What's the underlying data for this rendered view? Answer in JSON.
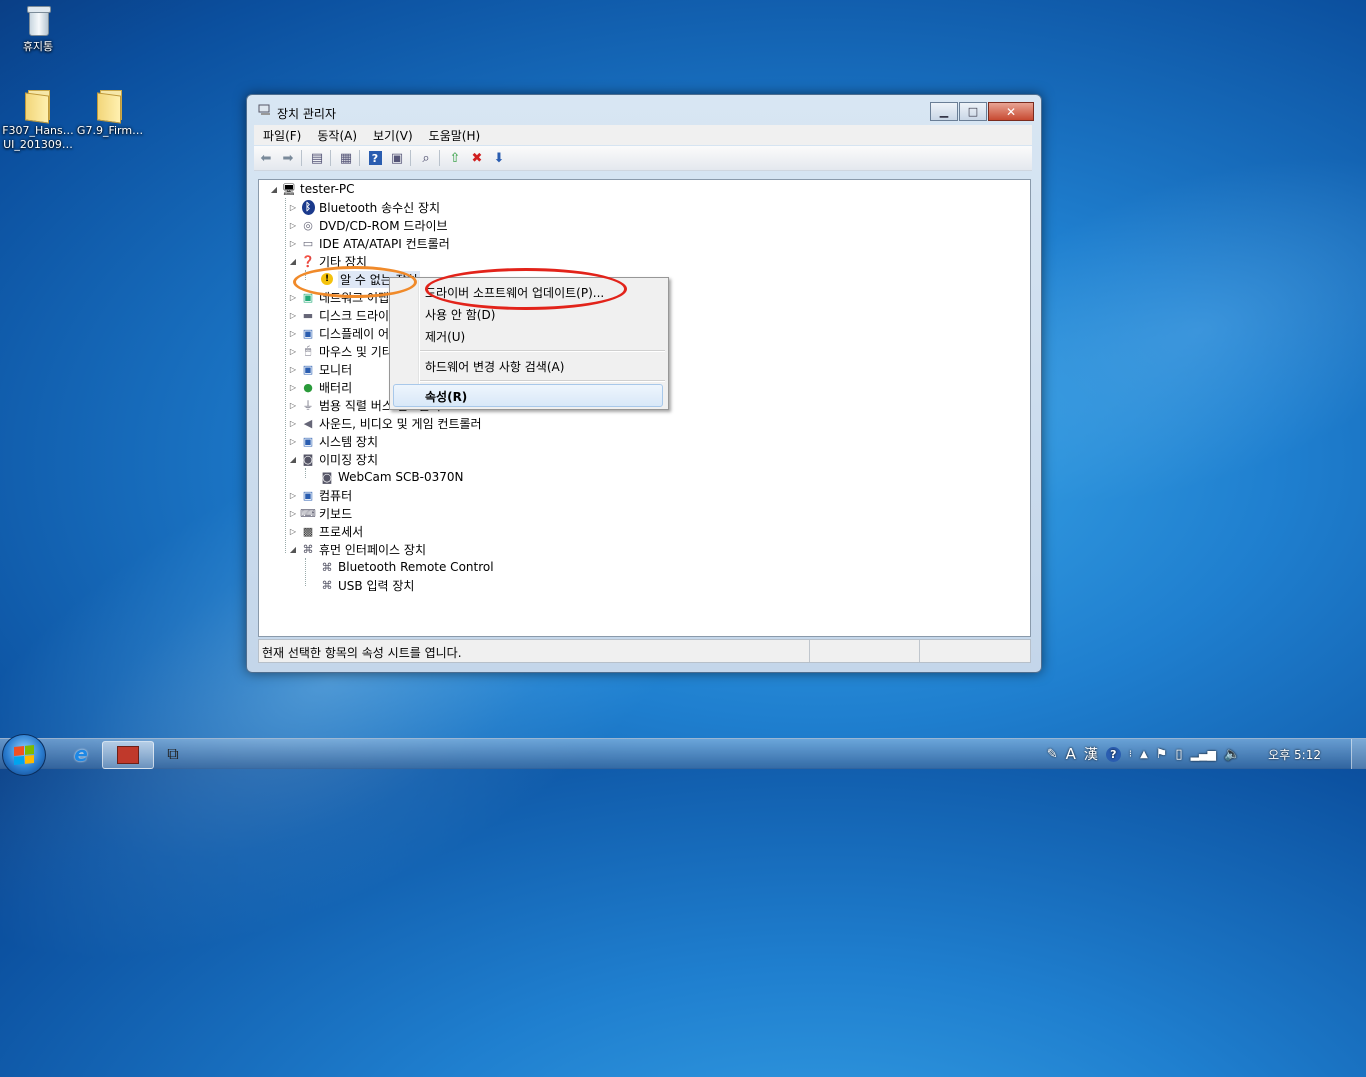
{
  "desktop": {
    "icons": [
      {
        "label": "휴지통"
      },
      {
        "label": "F307_Hans… UI_201309…"
      },
      {
        "label": "G7.9_Firm…"
      }
    ]
  },
  "window": {
    "title": "장치 관리자",
    "buttons": {
      "minimize": "▁",
      "maximize": "□",
      "close": "✕"
    }
  },
  "menubar": [
    "파일(F)",
    "동작(A)",
    "보기(V)",
    "도움말(H)"
  ],
  "tree": {
    "root": "tester-PC",
    "items": [
      {
        "label": "Bluetooth 송수신 장치"
      },
      {
        "label": "DVD/CD-ROM 드라이브"
      },
      {
        "label": "IDE ATA/ATAPI 컨트롤러"
      },
      {
        "label": "기타 장치"
      },
      {
        "label": "알 수 없는 장치"
      },
      {
        "label": "네트워크 어댑터"
      },
      {
        "label": "디스크 드라이브"
      },
      {
        "label": "디스플레이 어댑터"
      },
      {
        "label": "마우스 및 기타 포인팅 장치"
      },
      {
        "label": "모니터"
      },
      {
        "label": "배터리"
      },
      {
        "label": "범용 직렬 버스 컨트롤러"
      },
      {
        "label": "사운드, 비디오 및 게임 컨트롤러"
      },
      {
        "label": "시스템 장치"
      },
      {
        "label": "이미징 장치"
      },
      {
        "label": "WebCam SCB-0370N"
      },
      {
        "label": "컴퓨터"
      },
      {
        "label": "키보드"
      },
      {
        "label": "프로세서"
      },
      {
        "label": "휴먼 인터페이스 장치"
      },
      {
        "label": "Bluetooth Remote Control"
      },
      {
        "label": "USB 입력 장치"
      }
    ]
  },
  "context_menu": {
    "items": [
      "드라이버 소프트웨어 업데이트(P)...",
      "사용 안 함(D)",
      "제거(U)",
      "하드웨어 변경 사항 검색(A)",
      "속성(R)"
    ]
  },
  "statusbar": {
    "text": "현재 선택한 항목의 속성 시트를 엽니다."
  },
  "taskbar": {
    "tray": {
      "ime_lang": "A",
      "ime_hanja": "漢",
      "help": "?",
      "time": "오후 5:12"
    }
  },
  "colors": {
    "orange_ring": "#f08a2a",
    "red_ring": "#e2231a",
    "menu_highlight": "#d9e8f8"
  }
}
